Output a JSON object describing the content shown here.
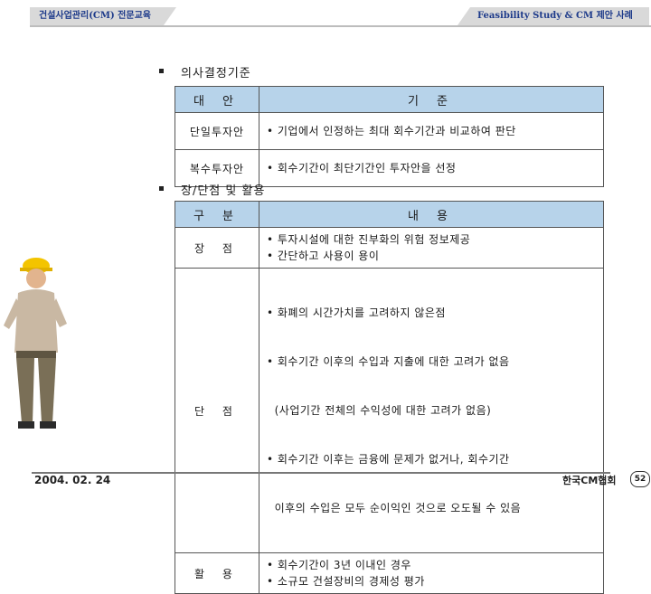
{
  "header": {
    "left_tag": "건설사업관리(CM) 전문교육",
    "right_tag": "Feasibility Study & CM 제안 사례"
  },
  "sections": [
    {
      "title": "의사결정기준",
      "col_headers": [
        "대 안",
        "기 준"
      ],
      "rows": [
        {
          "label": "단일투자안",
          "content": "• 기업에서 인정하는 최대 회수기간과 비교하여 판단"
        },
        {
          "label": "복수투자안",
          "content": "• 회수기간이 최단기간인 투자안을 선정"
        }
      ]
    },
    {
      "title": "장/단점 및 활용",
      "col_headers": [
        "구 분",
        "내 용"
      ],
      "rows": [
        {
          "label": "장 점",
          "lines": [
            "• 투자시설에 대한 진부화의 위험 정보제공",
            "• 간단하고 사용이 용이"
          ]
        },
        {
          "label": "단 점",
          "lines": [
            "• 화폐의 시간가치를 고려하지 않은점",
            "• 회수기간 이후의 수입과 지출에 대한 고려가 없음",
            "  (사업기간 전체의 수익성에 대한 고려가 없음)",
            "• 회수기간 이후는 금융에 문제가 없거나, 회수기간",
            "  이후의 수입은 모두 순이익인 것으로 오도될 수 있음"
          ]
        },
        {
          "label": "활 용",
          "lines": [
            "• 회수기간이 3년 이내인 경우",
            "• 소규모 건설장비의 경제성 평가"
          ]
        }
      ]
    }
  ],
  "footer": {
    "date": "2004. 02. 24",
    "org": "한국CM협회",
    "page": "52"
  },
  "colors": {
    "header_fill": "#b7d3ea",
    "tag_text": "#1d3a8a",
    "tag_fill": "#d9d9d9"
  },
  "illustration": "construction-worker-with-hardhat"
}
